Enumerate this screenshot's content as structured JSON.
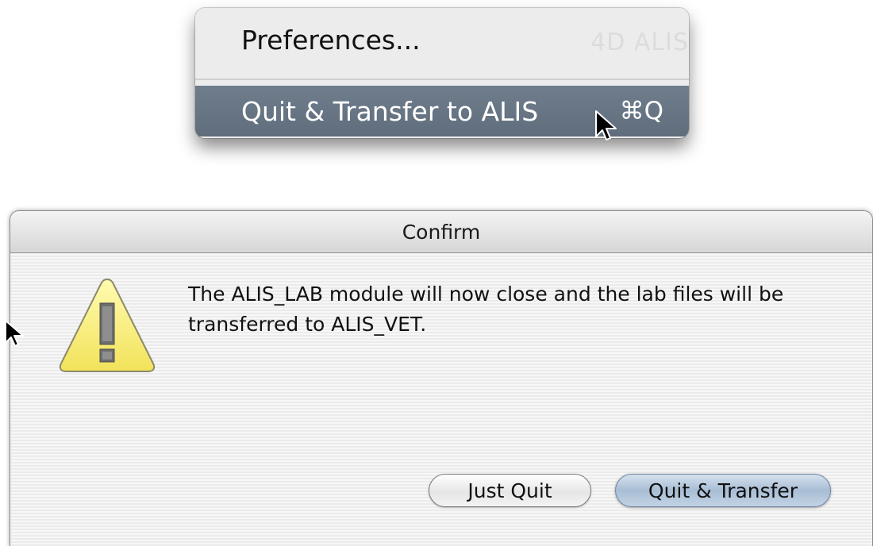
{
  "menu": {
    "items": [
      {
        "label": "Preferences...",
        "shortcut": ""
      },
      {
        "label": "Quit & Transfer to ALIS",
        "shortcut": "⌘Q",
        "highlighted": true
      }
    ],
    "ghost_text": "4D ALIS",
    "highlight_color": "#66737f"
  },
  "dialog": {
    "title": "Confirm",
    "icon": "warning-triangle-icon",
    "message": "The ALIS_LAB module will now close and the lab files will be transferred to ALIS_VET.",
    "buttons": {
      "cancel": "Just Quit",
      "default": "Quit & Transfer"
    },
    "default_button_color": "#a8bdd4"
  }
}
